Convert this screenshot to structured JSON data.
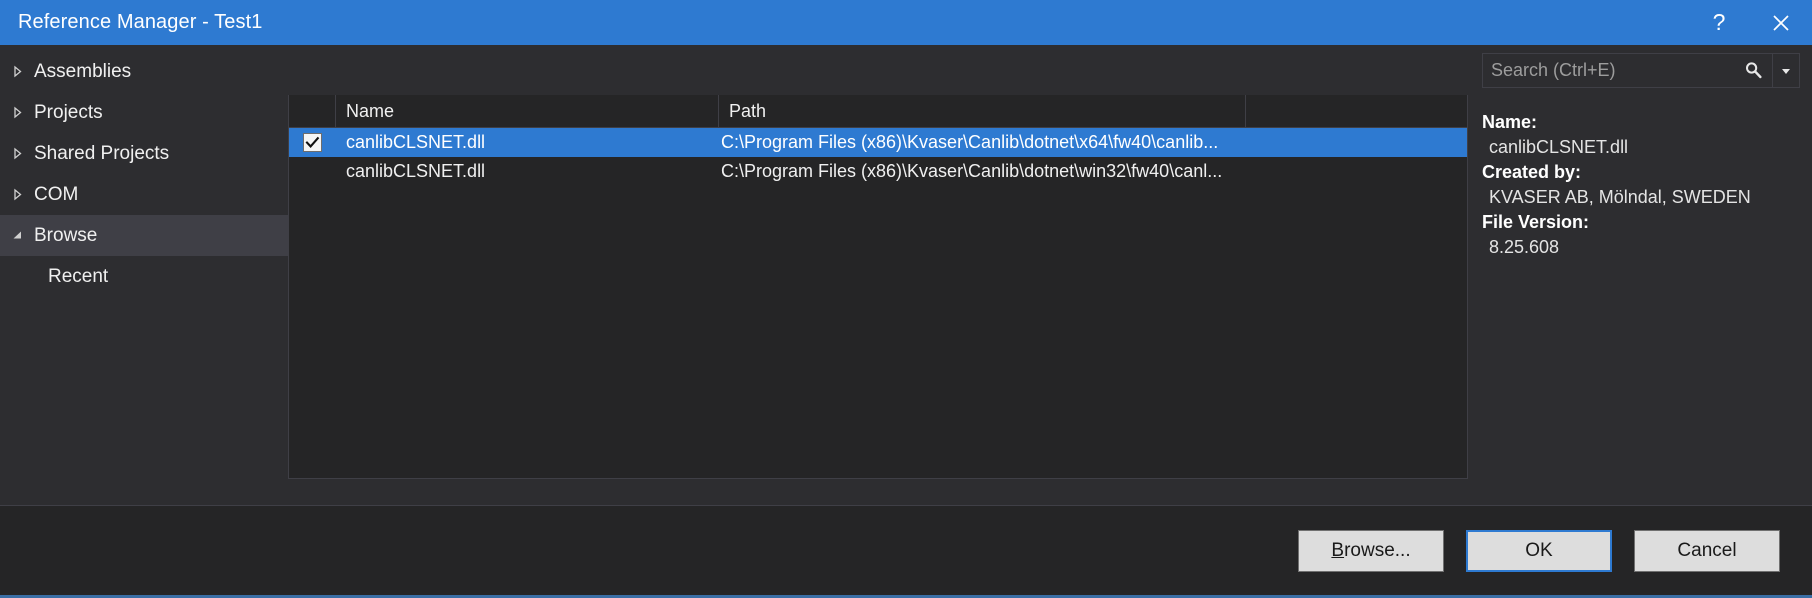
{
  "window": {
    "title": "Reference Manager - Test1",
    "help_button": "?",
    "close_button": "✕"
  },
  "sidebar": {
    "items": [
      {
        "label": "Assemblies",
        "expander": "chevron-right-icon",
        "selected": false,
        "child": false
      },
      {
        "label": "Projects",
        "expander": "chevron-right-icon",
        "selected": false,
        "child": false
      },
      {
        "label": "Shared Projects",
        "expander": "chevron-right-icon",
        "selected": false,
        "child": false
      },
      {
        "label": "COM",
        "expander": "chevron-right-icon",
        "selected": false,
        "child": false
      },
      {
        "label": "Browse",
        "expander": "chevron-down-icon",
        "selected": true,
        "child": false
      },
      {
        "label": "Recent",
        "expander": "none",
        "selected": false,
        "child": true
      }
    ]
  },
  "list": {
    "columns": [
      "",
      "Name",
      "Path",
      ""
    ],
    "rows": [
      {
        "checked": true,
        "name": "canlibCLSNET.dll",
        "path": "C:\\Program Files (x86)\\Kvaser\\Canlib\\dotnet\\x64\\fw40\\canlib...",
        "selected": true
      },
      {
        "checked": false,
        "name": "canlibCLSNET.dll",
        "path": "C:\\Program Files (x86)\\Kvaser\\Canlib\\dotnet\\win32\\fw40\\canl...",
        "selected": false
      }
    ]
  },
  "search": {
    "value": "",
    "placeholder": "Search (Ctrl+E)",
    "search_icon": "magnifier-icon",
    "dropdown_icon": "chevron-down-icon"
  },
  "details": {
    "name_label": "Name:",
    "name_value": "canlibCLSNET.dll",
    "created_by_label": "Created by:",
    "created_by_value": "KVASER AB, Mölndal, SWEDEN",
    "file_version_label": "File Version:",
    "file_version_value": "8.25.608"
  },
  "footer": {
    "browse_accel": "B",
    "browse_rest": "rowse...",
    "ok_label": "OK",
    "cancel_label": "Cancel"
  },
  "colors": {
    "titlebar": "#2e7ad1",
    "selection": "#2e7ad1",
    "dialog_bg": "#2d2d30",
    "list_bg": "#252526",
    "border": "#3f3f46",
    "sidebar_selected": "#3f3f46"
  }
}
